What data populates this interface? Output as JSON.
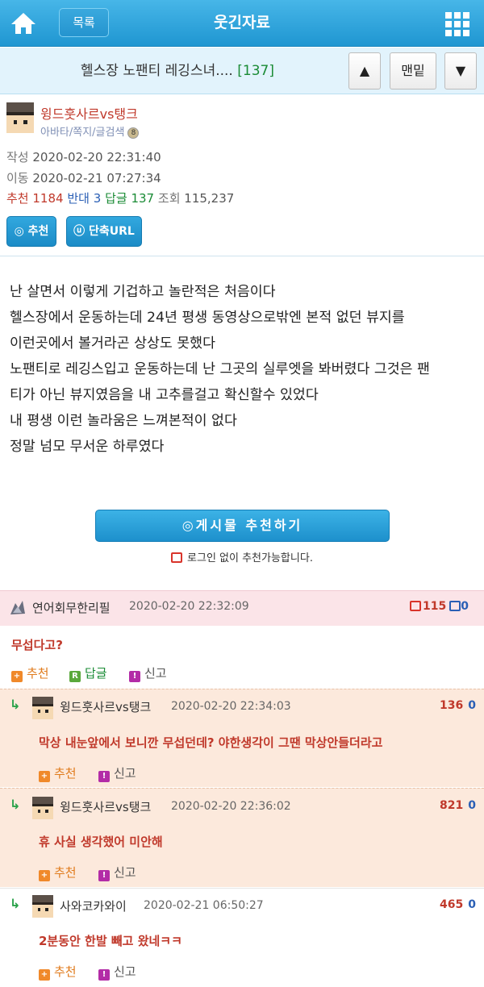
{
  "topbar": {
    "home_icon": "home-icon",
    "list_label": "목록",
    "title": "웃긴자료",
    "grid_icon": "grid-menu-icon"
  },
  "postbar": {
    "title": "헬스장 노팬티 레깅스녀....",
    "comment_count": "[137]",
    "up_icon": "▲",
    "bottom_label": "맨밑",
    "down_icon": "▼"
  },
  "author": {
    "name": "윙드훗사르vs탱크",
    "links": "아바타/쪽지/글검색",
    "created_label": "작성",
    "created": "2020-02-20 22:31:40",
    "moved_label": "이동",
    "moved": "2020-02-21 07:27:34",
    "stats": {
      "recommend_label": "추천",
      "recommend": "1184",
      "oppose_label": "반대",
      "oppose": "3",
      "reply_label": "답글",
      "reply": "137",
      "views_label": "조회",
      "views": "115,237"
    },
    "recommend_button": "추천",
    "short_url_button": "단축URL"
  },
  "body_lines": [
    "난 살면서 이렇게 기겁하고 놀란적은 처음이다",
    "헬스장에서 운동하는데 24년 평생 동영상으로밖엔 본적 없던 뷰지를",
    "이런곳에서 볼거라곤 상상도 못했다",
    "노팬티로 레깅스입고 운동하는데 난 그곳의 실루엣을 봐버렸다 그것은 팬",
    "티가 아닌 뷰지였음을 내 고추를걸고 확신할수 있었다",
    "내 평생 이런 놀라움은 느껴본적이 없다",
    "정말 넘모 무서운 하루였다"
  ],
  "recommend_big": "◎게시물  추천하기",
  "nologin_text": "로그인 없이 추천가능합니다.",
  "comments": [
    {
      "name": "연어회무한리필",
      "date": "2020-02-20 22:32:09",
      "up": "115",
      "down": "0",
      "text": "무섭다고?",
      "recommend": "추천",
      "reply": "답글",
      "report": "신고"
    },
    {
      "name": "윙드훗사르vs탱크",
      "date": "2020-02-20 22:34:03",
      "up": "136",
      "down": "0",
      "text": "막상 내눈앞에서 보니깐 무섭던데? 야한생각이 그땐 막상안들더라고",
      "recommend": "추천",
      "report": "신고"
    },
    {
      "name": "윙드훗사르vs탱크",
      "date": "2020-02-20 22:36:02",
      "up": "821",
      "down": "0",
      "text": "휴 사실 생각했어 미안해",
      "recommend": "추천",
      "report": "신고"
    },
    {
      "name": "사와코카와이",
      "date": "2020-02-21 06:50:27",
      "up": "465",
      "down": "0",
      "text": "2분동안 한발 빼고 왔네ㅋㅋ",
      "recommend": "추천",
      "report": "신고"
    }
  ],
  "colors": {
    "accent": "#1f96d1",
    "red_text": "#c0392b",
    "reply_bg": "#fce9dc",
    "comment_head_bg": "#fbe4e8"
  }
}
